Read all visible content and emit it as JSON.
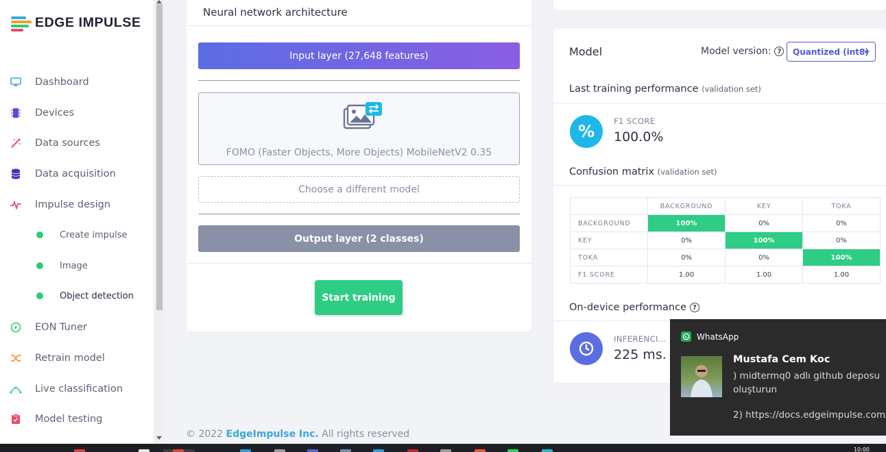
{
  "brand": {
    "name": "EDGE IMPULSE",
    "logo_colors": [
      "#3aa8d8",
      "#f39c2e",
      "#2ecc71",
      "#e74c6c"
    ]
  },
  "sidebar": {
    "items": [
      {
        "label": "Dashboard",
        "icon": "monitor-icon",
        "color": "#3aa8d8"
      },
      {
        "label": "Devices",
        "icon": "chip-icon",
        "color": "#5b4fd5"
      },
      {
        "label": "Data sources",
        "icon": "magic-wand-icon",
        "color": "#e74c6c"
      },
      {
        "label": "Data acquisition",
        "icon": "database-icon",
        "color": "#4b2fbf"
      },
      {
        "label": "Impulse design",
        "icon": "pulse-icon",
        "color": "#e74c6c"
      },
      {
        "label": "Create impulse"
      },
      {
        "label": "Image"
      },
      {
        "label": "Object detection"
      },
      {
        "label": "EON Tuner",
        "icon": "compass-icon",
        "color": "#2ecc71"
      },
      {
        "label": "Retrain model",
        "icon": "shuffle-icon",
        "color": "#f39c2e"
      },
      {
        "label": "Live classification",
        "icon": "signal-icon",
        "color": "#2ecc71"
      },
      {
        "label": "Model testing",
        "icon": "clipboard-icon",
        "color": "#e74c6c"
      }
    ]
  },
  "nn": {
    "title": "Neural network architecture",
    "input_layer": "Input layer (27,648 features)",
    "model_name": "FOMO (Faster Objects, More Objects) MobileNetV2 0.35",
    "choose_model": "Choose a different model",
    "output_layer": "Output layer (2 classes)",
    "start_training": "Start training"
  },
  "model": {
    "title": "Model",
    "version_label": "Model version:",
    "version_value": "Quantized (int8)",
    "last_training": "Last training performance",
    "validation_set": "(validation set)",
    "f1_label": "F1 SCORE",
    "f1_value": "100.0%",
    "confusion_title": "Confusion matrix",
    "confusion_validation": "(validation set)",
    "confusion": {
      "columns": [
        "BACKGROUND",
        "KEY",
        "TOKA"
      ],
      "rows": [
        {
          "label": "BACKGROUND",
          "values": [
            "100%",
            "0%",
            "0%"
          ]
        },
        {
          "label": "KEY",
          "values": [
            "0%",
            "100%",
            "0%"
          ]
        },
        {
          "label": "TOKA",
          "values": [
            "0%",
            "0%",
            "100%"
          ]
        },
        {
          "label": "F1 SCORE",
          "values": [
            "1.00",
            "1.00",
            "1.00"
          ]
        }
      ]
    },
    "on_device_title": "On-device performance",
    "inferencing_label": "INFERENCI...",
    "inferencing_value": "225 ms."
  },
  "footer": {
    "copyright": "© 2022",
    "company": "EdgeImpulse Inc.",
    "rights": "All rights reserved"
  },
  "notification": {
    "app": "WhatsApp",
    "sender": "Mustafa Cem Koc",
    "message": ") midtermq0 adlı github deposu oluşturun",
    "message2": "2) https://docs.edgeimpulse.com/"
  },
  "taskbar": {
    "clock": "10:00"
  },
  "colors": {
    "accent": "#4f5bd5",
    "success": "#2ecc85",
    "output_layer": "#8a90a6"
  }
}
